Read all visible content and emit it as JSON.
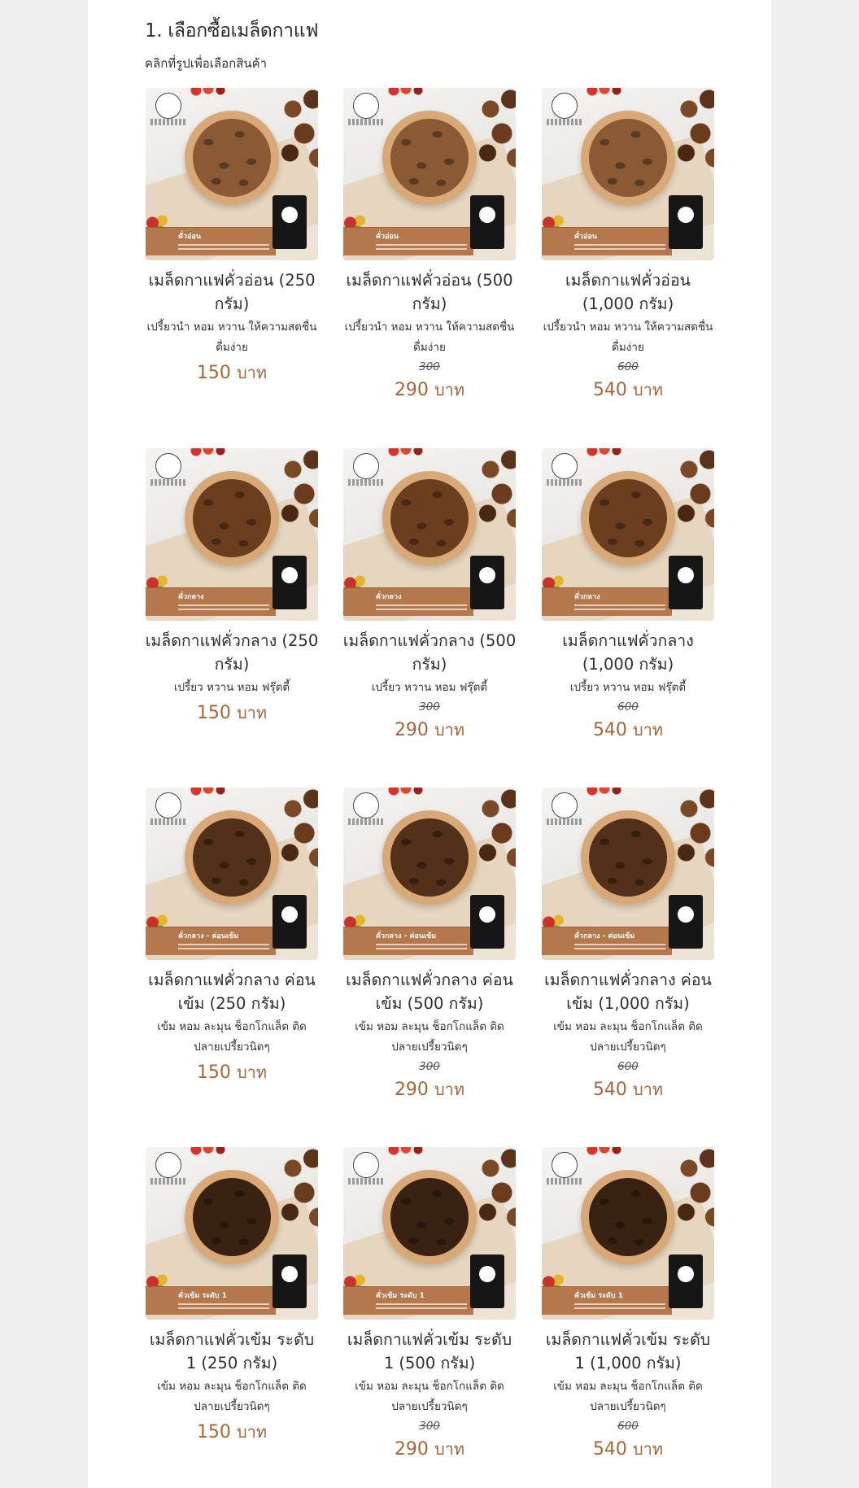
{
  "section": {
    "title": "1. เลือกซื้อเมล็ดกาแฟ",
    "instruction": "คลิกที่รูปเพื่อเลือกสินค้า"
  },
  "currency_label": "บาท",
  "accent_color": "#a5673a",
  "products": [
    {
      "name": "เมล็ดกาแฟคั่วอ่อน (250 กรัม)",
      "desc": "เปรี้ยวนำ หอม หวาน ให้ความสดชื่น ดื่มง่าย",
      "old_price": "",
      "price": "150",
      "banner": "คั่วอ่อน"
    },
    {
      "name": "เมล็ดกาแฟคั่วอ่อน (500 กรัม)",
      "desc": "เปรี้ยวนำ หอม หวาน ให้ความสดชื่น ดื่มง่าย",
      "old_price": "300",
      "price": "290",
      "banner": "คั่วอ่อน"
    },
    {
      "name": "เมล็ดกาแฟคั่วอ่อน (1,000 กรัม)",
      "desc": "เปรี้ยวนำ หอม หวาน ให้ความสดชื่น ดื่มง่าย",
      "old_price": "600",
      "price": "540",
      "banner": "คั่วอ่อน"
    },
    {
      "name": "เมล็ดกาแฟคั่วกลาง (250 กรัม)",
      "desc": "เปรี้ยว หวาน หอม ฟรุ๊ตตี้",
      "old_price": "",
      "price": "150",
      "banner": "คั่วกลาง"
    },
    {
      "name": "เมล็ดกาแฟคั่วกลาง (500 กรัม)",
      "desc": "เปรี้ยว หวาน หอม ฟรุ๊ตตี้",
      "old_price": "300",
      "price": "290",
      "banner": "คั่วกลาง"
    },
    {
      "name": "เมล็ดกาแฟคั่วกลาง (1,000 กรัม)",
      "desc": "เปรี้ยว หวาน หอม ฟรุ๊ตตี้",
      "old_price": "600",
      "price": "540",
      "banner": "คั่วกลาง"
    },
    {
      "name": "เมล็ดกาแฟคั่วกลาง ค่อนเข้ม (250 กรัม)",
      "desc": "เข้ม หอม ละมุน ช็อกโกแล็ต ติดปลายเปรี้ยวนิดๆ",
      "old_price": "",
      "price": "150",
      "banner": "คั่วกลาง - ค่อนเข้ม"
    },
    {
      "name": "เมล็ดกาแฟคั่วกลาง ค่อนเข้ม (500 กรัม)",
      "desc": "เข้ม หอม ละมุน ช็อกโกแล็ต ติดปลายเปรี้ยวนิดๆ",
      "old_price": "300",
      "price": "290",
      "banner": "คั่วกลาง - ค่อนเข้ม"
    },
    {
      "name": "เมล็ดกาแฟคั่วกลาง ค่อนเข้ม (1,000 กรัม)",
      "desc": "เข้ม หอม ละมุน ช็อกโกแล็ต ติดปลายเปรี้ยวนิดๆ",
      "old_price": "600",
      "price": "540",
      "banner": "คั่วกลาง - ค่อนเข้ม"
    },
    {
      "name": "เมล็ดกาแฟคั่วเข้ม ระดับ 1 (250 กรัม)",
      "desc": "เข้ม หอม ละมุน ช็อกโกแล็ต ติดปลายเปรี้ยวนิดๆ",
      "old_price": "",
      "price": "150",
      "banner": "คั่วเข้ม ระดับ 1"
    },
    {
      "name": "เมล็ดกาแฟคั่วเข้ม ระดับ 1 (500 กรัม)",
      "desc": "เข้ม หอม ละมุน ช็อกโกแล็ต ติดปลายเปรี้ยวนิดๆ",
      "old_price": "300",
      "price": "290",
      "banner": "คั่วเข้ม ระดับ 1"
    },
    {
      "name": "เมล็ดกาแฟคั่วเข้ม ระดับ 1 (1,000 กรัม)",
      "desc": "เข้ม หอม ละมุน ช็อกโกแล็ต ติดปลายเปรี้ยวนิดๆ",
      "old_price": "600",
      "price": "540",
      "banner": "คั่วเข้ม ระดับ 1"
    }
  ]
}
